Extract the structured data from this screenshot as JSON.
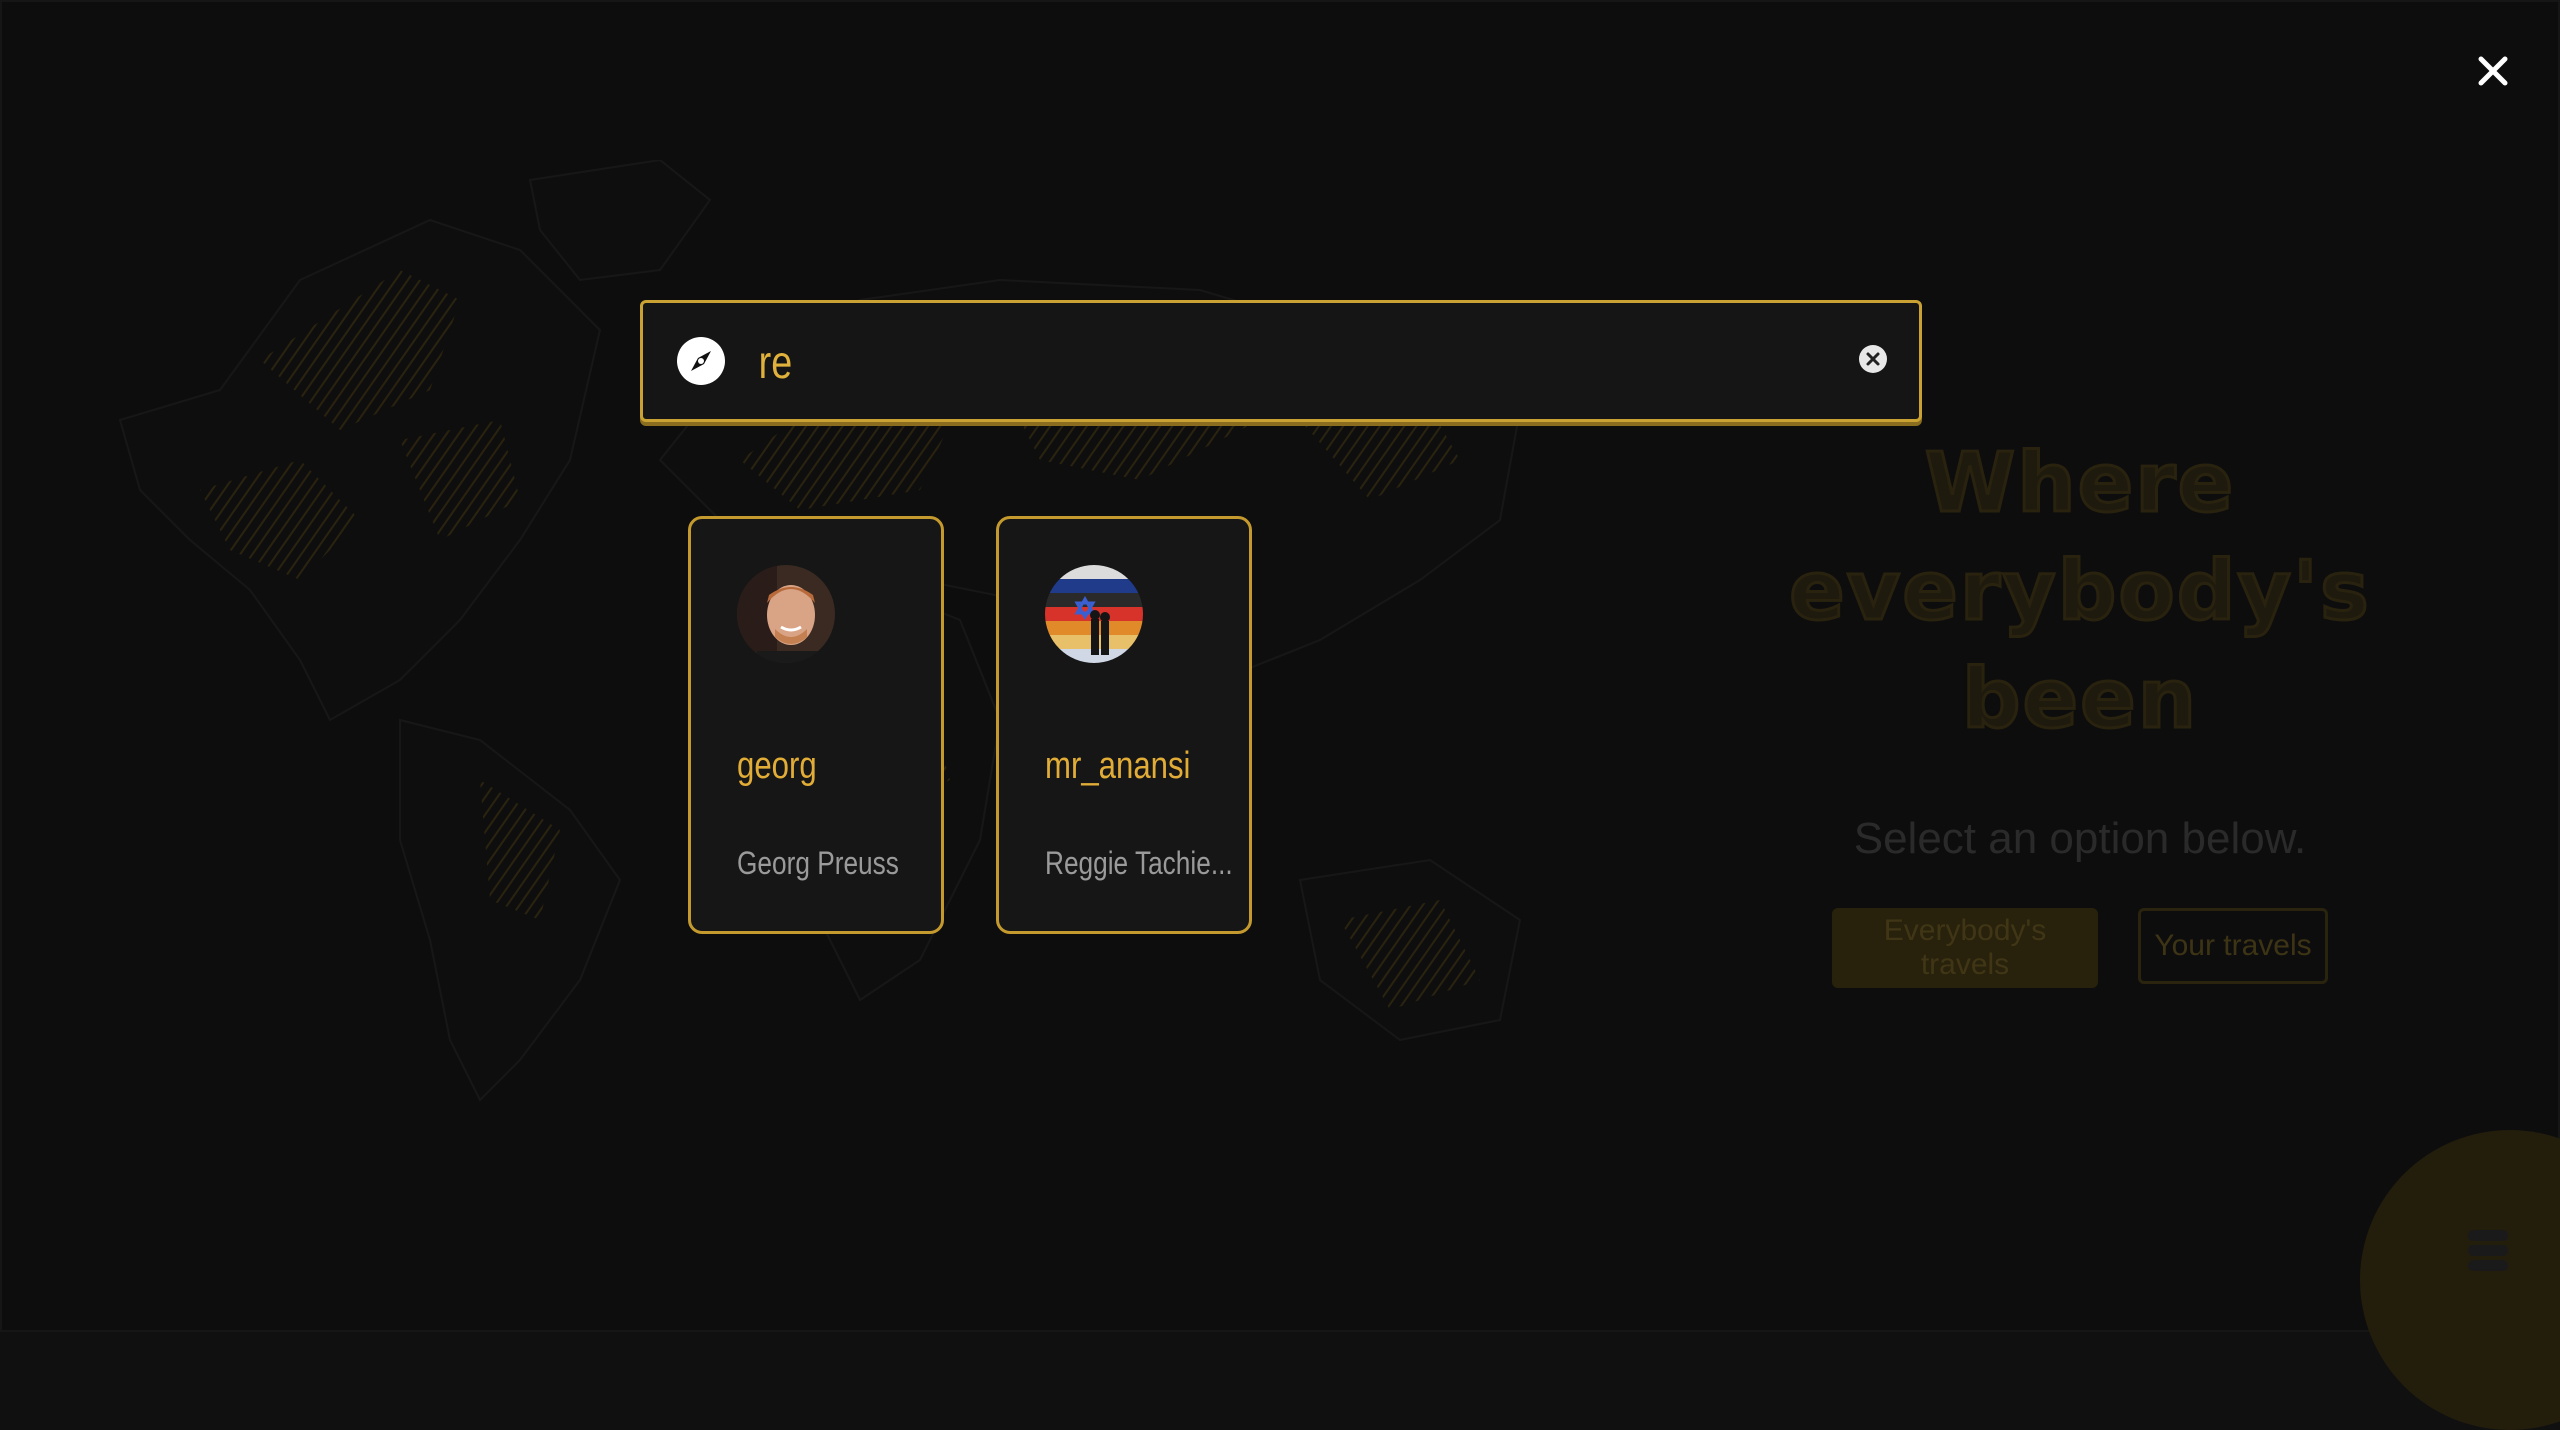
{
  "search": {
    "value": "re",
    "compass_icon": "compass-icon",
    "clear_icon": "clear-circle-icon"
  },
  "close_icon": "close-icon",
  "results": [
    {
      "username": "georg",
      "full_name": "Georg Preuss"
    },
    {
      "username": "mr_anansi",
      "full_name": "Reggie Tachie..."
    }
  ],
  "hero": {
    "title_line1": "Where",
    "title_line2": "everybody's been",
    "subtitle": "Select an option below.",
    "everybody_button": "Everybody's travels",
    "your_button": "Your travels"
  },
  "menu_icon": "stack-menu-icon",
  "colors": {
    "accent": "#e2ad37",
    "border_gold": "#c9a233",
    "background": "#101010",
    "card_bg": "#161616"
  }
}
